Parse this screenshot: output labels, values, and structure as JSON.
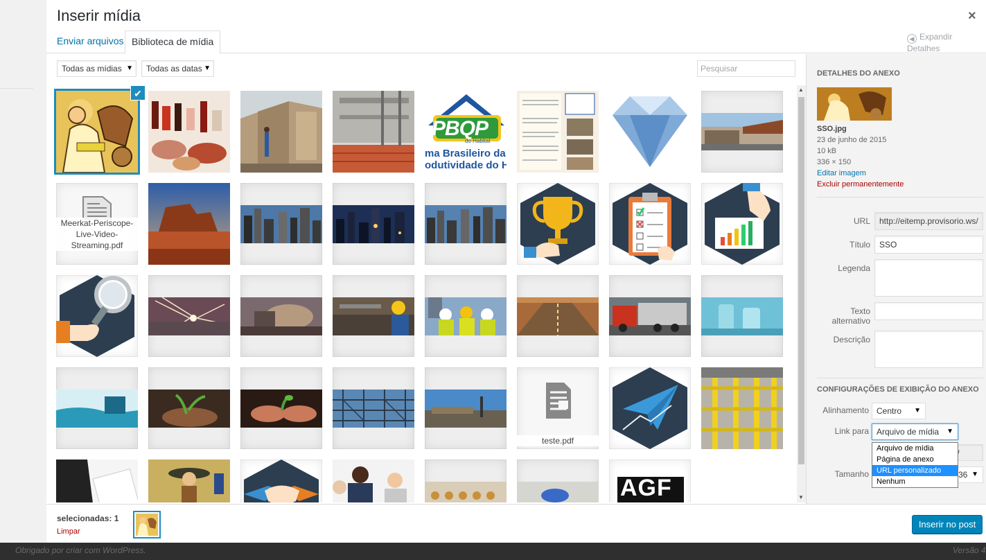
{
  "modal": {
    "title": "Inserir mídia",
    "close_label": "×"
  },
  "tabs": [
    {
      "label": "Enviar arquivos",
      "active": false
    },
    {
      "label": "Biblioteca de mídia",
      "active": true
    }
  ],
  "expand_details": "Expandir Detalhes",
  "filters": {
    "type_selected": "Todas as mídias",
    "date_selected": "Todas as datas",
    "search_placeholder": "Pesquisar"
  },
  "media_grid": {
    "rows": [
      [
        "worker-illustration",
        "food-products",
        "construction-wall",
        "brick-building",
        "pbqp-logo",
        "pbqp-document",
        "diamond",
        "factory-building"
      ],
      [
        "pdf-file",
        "desert-canyon",
        "city-skyline",
        "city-night",
        "city-skyline-2",
        "trophy-icon",
        "checklist-icon",
        "chart-icon"
      ],
      [
        "magnifier-icon",
        "welding-sparks",
        "welder-working",
        "construction-workers",
        "workers-helmets",
        "highway",
        "truck",
        "lab-glass"
      ],
      [
        "lab-research",
        "plant-hands",
        "seedling-hands",
        "scaffolding",
        "industrial-site",
        "pdf-file",
        "paper-plane-icon",
        "factory-line"
      ],
      [
        "business-suit",
        "cartoon-figure",
        "handshake-icon",
        "business-people",
        "food-production",
        "gloves-factory",
        "agf-logo"
      ]
    ],
    "selected_index": 0,
    "file_labels": {
      "pdf1": "Meerkat-Periscope-Live-Video-Streaming.pdf",
      "pdf2": "teste.pdf"
    },
    "agf_text": "AGF",
    "pbqp_lines": [
      "ma Brasileiro da Q",
      "odutividade do Ha"
    ],
    "pbqp_brand": "PBQP",
    "pbqp_sub": "do Habitat"
  },
  "details": {
    "heading": "Detalhes do anexo",
    "filename": "SSO.jpg",
    "date": "23 de junho de 2015",
    "size": "10 kB",
    "dimensions": "336 × 150",
    "edit_link": "Editar imagem",
    "delete_link": "Excluir permanentemente",
    "url_label": "URL",
    "url_value": "http://eitemp.provisorio.ws/",
    "title_label": "Título",
    "title_value": "SSO",
    "caption_label": "Legenda",
    "alt_label_1": "Texto",
    "alt_label_2": "alternativo",
    "desc_label": "Descrição"
  },
  "display_settings": {
    "heading": "Configurações de exibição do anexo",
    "align_label": "Alinhamento",
    "align_value": "Centro",
    "link_label": "Link para",
    "link_value": "Arquivo de mídia",
    "link_options": [
      "Arquivo de mídia",
      "Página de anexo",
      "URL personalizado",
      "Nenhum"
    ],
    "link_highlighted": "URL personalizado",
    "hidden_url_tail": "io.ws/",
    "size_label": "Tamanho",
    "size_value_tail": "36"
  },
  "bottom": {
    "selected_text": "selecionadas: 1",
    "clear_label": "Limpar",
    "insert_button": "Inserir no post"
  },
  "footer": {
    "left": "Obrigado por criar com WordPress.",
    "right": "Versão 4"
  },
  "colors": {
    "accent": "#0073aa",
    "selection": "#1e8cbe",
    "primary_button": "#0085ba",
    "delete": "#aa0000"
  }
}
